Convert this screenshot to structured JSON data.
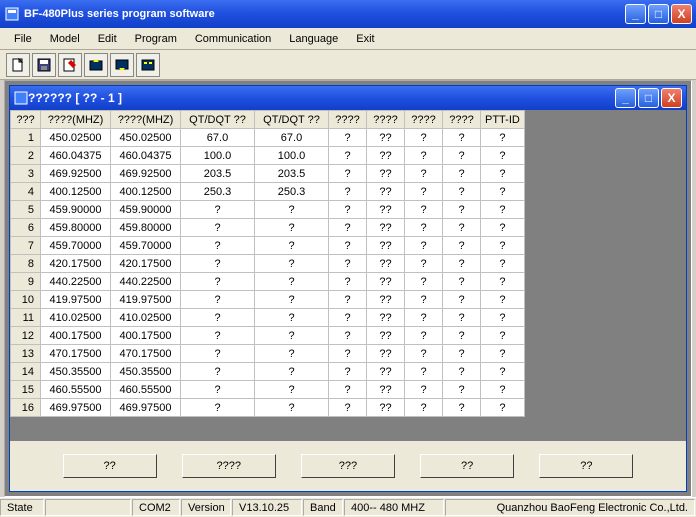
{
  "window": {
    "title": "BF-480Plus series program software",
    "min": "_",
    "max": "□",
    "close": "X"
  },
  "menu": [
    "File",
    "Model",
    "Edit",
    "Program",
    "Communication",
    "Language",
    "Exit"
  ],
  "toolbar_icons": [
    "new-icon",
    "save-icon",
    "edit-icon",
    "read-icon",
    "write-icon",
    "config-icon"
  ],
  "child": {
    "title": "?????? [ ??  -  1 ]"
  },
  "table": {
    "headers": [
      "???",
      "????(MHZ)",
      "????(MHZ)",
      "QT/DQT ??",
      "QT/DQT ??",
      "????",
      "????",
      "????",
      "????",
      "PTT-ID"
    ],
    "rows": [
      [
        "1",
        "450.02500",
        "450.02500",
        "67.0",
        "67.0",
        "?",
        "??",
        "?",
        "?",
        "?"
      ],
      [
        "2",
        "460.04375",
        "460.04375",
        "100.0",
        "100.0",
        "?",
        "??",
        "?",
        "?",
        "?"
      ],
      [
        "3",
        "469.92500",
        "469.92500",
        "203.5",
        "203.5",
        "?",
        "??",
        "?",
        "?",
        "?"
      ],
      [
        "4",
        "400.12500",
        "400.12500",
        "250.3",
        "250.3",
        "?",
        "??",
        "?",
        "?",
        "?"
      ],
      [
        "5",
        "459.90000",
        "459.90000",
        "?",
        "?",
        "?",
        "??",
        "?",
        "?",
        "?"
      ],
      [
        "6",
        "459.80000",
        "459.80000",
        "?",
        "?",
        "?",
        "??",
        "?",
        "?",
        "?"
      ],
      [
        "7",
        "459.70000",
        "459.70000",
        "?",
        "?",
        "?",
        "??",
        "?",
        "?",
        "?"
      ],
      [
        "8",
        "420.17500",
        "420.17500",
        "?",
        "?",
        "?",
        "??",
        "?",
        "?",
        "?"
      ],
      [
        "9",
        "440.22500",
        "440.22500",
        "?",
        "?",
        "?",
        "??",
        "?",
        "?",
        "?"
      ],
      [
        "10",
        "419.97500",
        "419.97500",
        "?",
        "?",
        "?",
        "??",
        "?",
        "?",
        "?"
      ],
      [
        "11",
        "410.02500",
        "410.02500",
        "?",
        "?",
        "?",
        "??",
        "?",
        "?",
        "?"
      ],
      [
        "12",
        "400.17500",
        "400.17500",
        "?",
        "?",
        "?",
        "??",
        "?",
        "?",
        "?"
      ],
      [
        "13",
        "470.17500",
        "470.17500",
        "?",
        "?",
        "?",
        "??",
        "?",
        "?",
        "?"
      ],
      [
        "14",
        "450.35500",
        "450.35500",
        "?",
        "?",
        "?",
        "??",
        "?",
        "?",
        "?"
      ],
      [
        "15",
        "460.55500",
        "460.55500",
        "?",
        "?",
        "?",
        "??",
        "?",
        "?",
        "?"
      ],
      [
        "16",
        "469.97500",
        "469.97500",
        "?",
        "?",
        "?",
        "??",
        "?",
        "?",
        "?"
      ]
    ]
  },
  "buttons": [
    "??",
    "????",
    "???",
    "??",
    "??"
  ],
  "status": {
    "state_label": "State",
    "state_value": "",
    "com": "COM2",
    "version_label": "Version",
    "version_value": "V13.10.25",
    "band_label": "Band",
    "band_value": "400-- 480 MHZ",
    "company": "Quanzhou BaoFeng Electronic Co.,Ltd."
  }
}
